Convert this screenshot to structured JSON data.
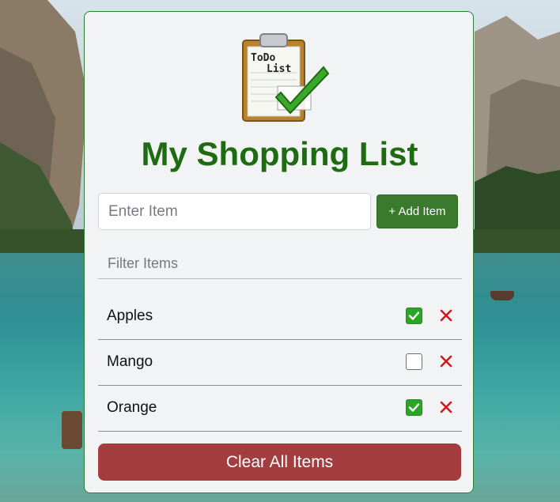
{
  "app": {
    "title": "My Shopping List",
    "logo_text": [
      "ToDo",
      "List"
    ]
  },
  "add_form": {
    "item_placeholder": "Enter Item",
    "item_value": "",
    "add_label": "+ Add Item"
  },
  "filter": {
    "placeholder": "Filter Items",
    "value": ""
  },
  "items": [
    {
      "label": "Apples",
      "checked": true
    },
    {
      "label": "Mango",
      "checked": false
    },
    {
      "label": "Orange",
      "checked": true
    }
  ],
  "clear_label": "Clear All Items",
  "colors": {
    "title": "#1e6b12",
    "add_button": "#3a7a2c",
    "check_on": "#2aa526",
    "delete": "#d0191f",
    "clear_button": "#a33d3f"
  }
}
